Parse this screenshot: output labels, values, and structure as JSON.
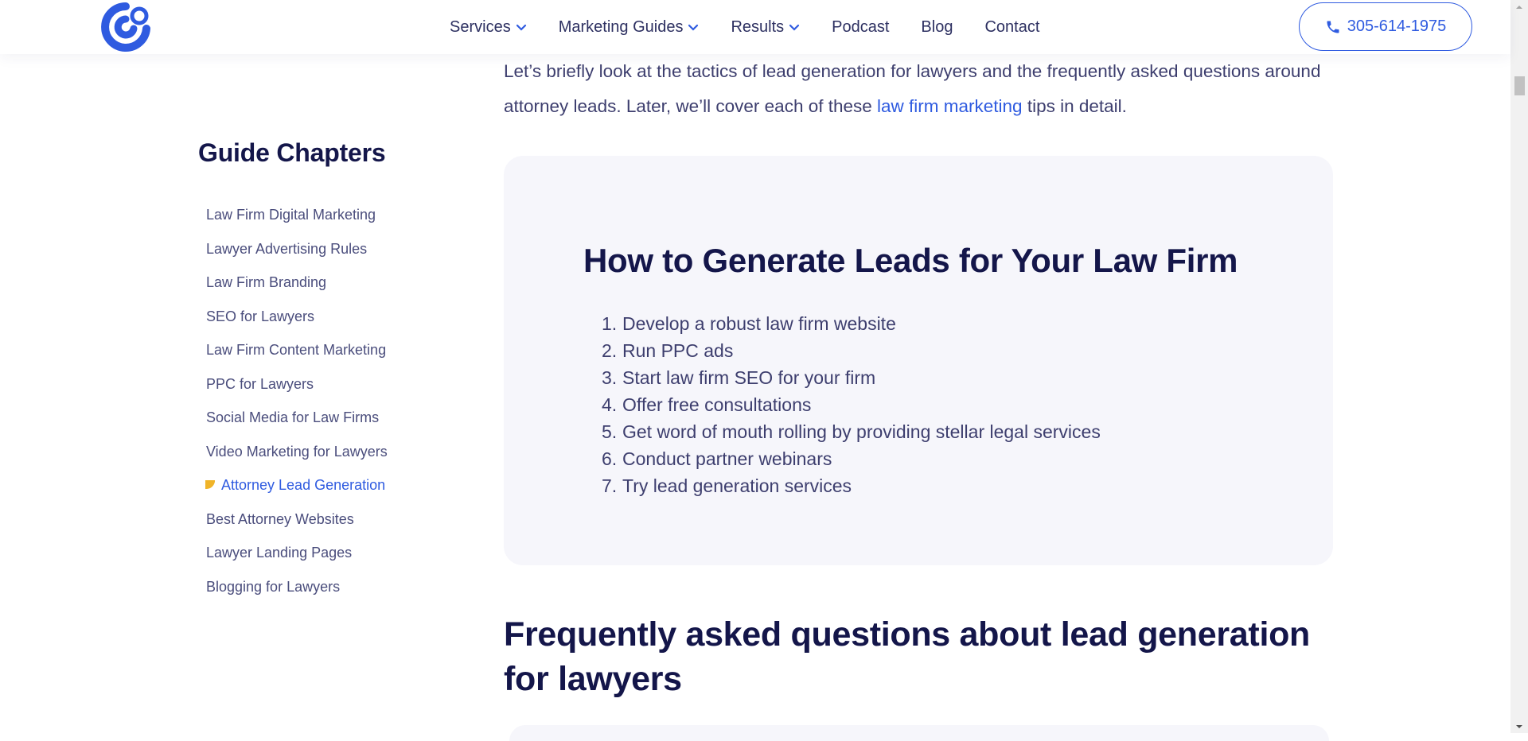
{
  "header": {
    "logo_icon": "brand-logo-icon",
    "nav": [
      {
        "label": "Services",
        "has_dropdown": true
      },
      {
        "label": "Marketing Guides",
        "has_dropdown": true
      },
      {
        "label": "Results",
        "has_dropdown": true
      },
      {
        "label": "Podcast",
        "has_dropdown": false
      },
      {
        "label": "Blog",
        "has_dropdown": false
      },
      {
        "label": "Contact",
        "has_dropdown": false
      }
    ],
    "phone": "305-614-1975",
    "phone_icon": "phone-icon"
  },
  "sidebar": {
    "title": "Guide Chapters",
    "chapters": [
      {
        "label": "Law Firm Digital Marketing"
      },
      {
        "label": "Lawyer Advertising Rules"
      },
      {
        "label": "Law Firm Branding"
      },
      {
        "label": "SEO for Lawyers"
      },
      {
        "label": "Law Firm Content Marketing"
      },
      {
        "label": "PPC for Lawyers"
      },
      {
        "label": "Social Media for Law Firms"
      },
      {
        "label": "Video Marketing for Lawyers"
      },
      {
        "label": "Attorney Lead Generation"
      },
      {
        "label": "Best Attorney Websites"
      },
      {
        "label": "Lawyer Landing Pages"
      },
      {
        "label": "Blogging for Lawyers"
      }
    ],
    "active_chapter": "Attorney Lead Generation"
  },
  "main": {
    "intro": {
      "before": "Let’s briefly look at the tactics of lead generation for lawyers and the frequently asked questions around attorney leads. Later, we’ll cover each of these ",
      "link": "law firm marketing",
      "after": " tips in detail."
    },
    "card": {
      "title": "How to Generate Leads for Your Law Firm",
      "steps": [
        {
          "num": "1.",
          "text": "Develop a robust law firm website"
        },
        {
          "num": "2.",
          "text": "Run PPC ads"
        },
        {
          "num": "3.",
          "text": "Start law firm SEO for your firm"
        },
        {
          "num": "4.",
          "text": "Offer free consultations"
        },
        {
          "num": "5.",
          "text": "Get word of mouth rolling by providing stellar legal services"
        },
        {
          "num": "6.",
          "text": "Conduct partner webinars"
        },
        {
          "num": "7.",
          "text": "Try lead generation services"
        }
      ]
    },
    "faq_title": "Frequently asked questions about lead generation for lawyers"
  },
  "colors": {
    "accent": "#2f5be0",
    "heading": "#14164a",
    "body_text": "#3d3e6e",
    "card_bg": "#f6f6fb",
    "active_marker": "#f0b429"
  }
}
